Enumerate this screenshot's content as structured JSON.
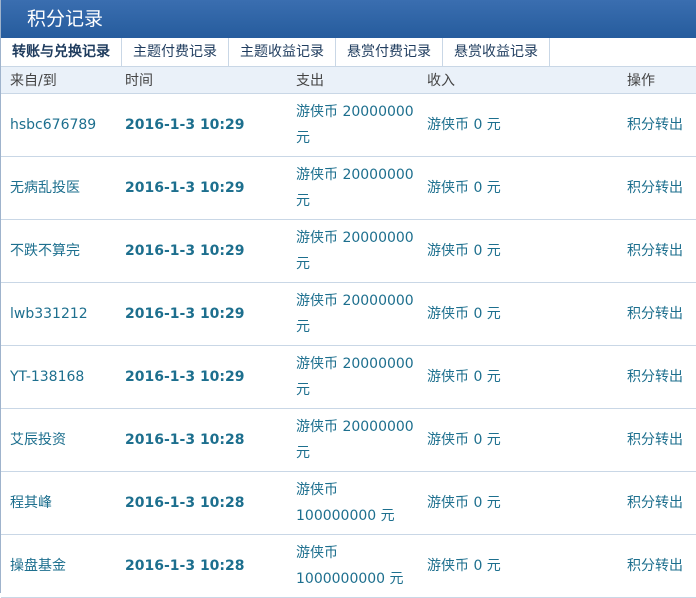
{
  "title": "积分记录",
  "tabs": [
    "转账与兑换记录",
    "主题付费记录",
    "主题收益记录",
    "悬赏付费记录",
    "悬赏收益记录"
  ],
  "active_tab": 0,
  "columns": [
    "来自/到",
    "时间",
    "支出",
    "收入",
    "操作"
  ],
  "rows": [
    {
      "from": "hsbc676789",
      "time": "2016-1-3 10:29",
      "out": "游侠币 20000000 元",
      "in": "游侠币 0 元",
      "op": "积分转出"
    },
    {
      "from": "无病乱投医",
      "time": "2016-1-3 10:29",
      "out": "游侠币 20000000 元",
      "in": "游侠币 0 元",
      "op": "积分转出"
    },
    {
      "from": "不跌不算完",
      "time": "2016-1-3 10:29",
      "out": "游侠币 20000000 元",
      "in": "游侠币 0 元",
      "op": "积分转出"
    },
    {
      "from": "lwb331212",
      "time": "2016-1-3 10:29",
      "out": "游侠币 20000000 元",
      "in": "游侠币 0 元",
      "op": "积分转出"
    },
    {
      "from": "YT-138168",
      "time": "2016-1-3 10:29",
      "out": "游侠币 20000000 元",
      "in": "游侠币 0 元",
      "op": "积分转出"
    },
    {
      "from": "艾辰投资",
      "time": "2016-1-3 10:28",
      "out": "游侠币 20000000 元",
      "in": "游侠币 0 元",
      "op": "积分转出"
    },
    {
      "from": "程其峰",
      "time": "2016-1-3 10:28",
      "out": "游侠币 100000000 元",
      "in": "游侠币 0 元",
      "op": "积分转出"
    },
    {
      "from": "操盘基金",
      "time": "2016-1-3 10:28",
      "out": "游侠币 1000000000 元",
      "in": "游侠币 0 元",
      "op": "积分转出"
    }
  ]
}
